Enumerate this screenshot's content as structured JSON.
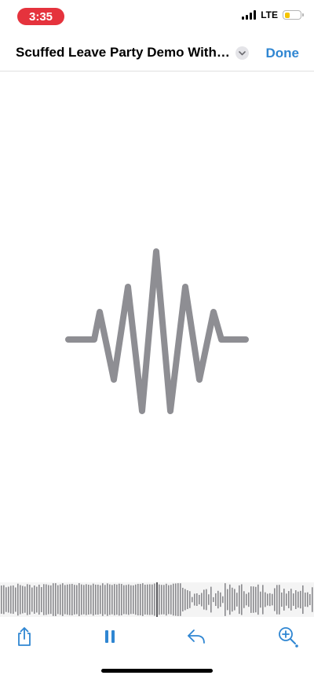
{
  "status_bar": {
    "time": "3:35",
    "network": "LTE",
    "battery_color": "#f5c400",
    "battery_level": 0.35,
    "time_pill_color": "#e5333d"
  },
  "nav": {
    "title": "Scuffed Leave Party Demo With D...",
    "done_label": "Done",
    "accent_color": "#2f86d2"
  },
  "player": {
    "glyph": "waveform-icon",
    "glyph_color": "#8e8e93",
    "toolbar_icons": [
      "share-icon",
      "pause-icon",
      "reply-icon",
      "zoom-in-icon"
    ]
  }
}
